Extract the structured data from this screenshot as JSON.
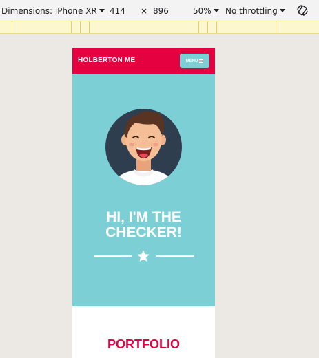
{
  "devtools": {
    "dimensions_label": "Dimensions: iPhone XR",
    "width": "414",
    "times": "×",
    "height": "896",
    "zoom": "50%",
    "throttling": "No throttling"
  },
  "site": {
    "brand": "HOLBERTON ME",
    "menu_label": "MENU",
    "hero_title_line1": "HI, I'M THE",
    "hero_title_line2": "CHECKER!",
    "portfolio_title": "PORTFOLIO"
  },
  "colors": {
    "header_red": "#e5003f",
    "hero_teal": "#7ccfd5",
    "avatar_circle": "#2e3e4e"
  },
  "icons": {
    "rotate": "rotate-icon",
    "menu": "hamburger-icon",
    "star": "star-icon"
  }
}
